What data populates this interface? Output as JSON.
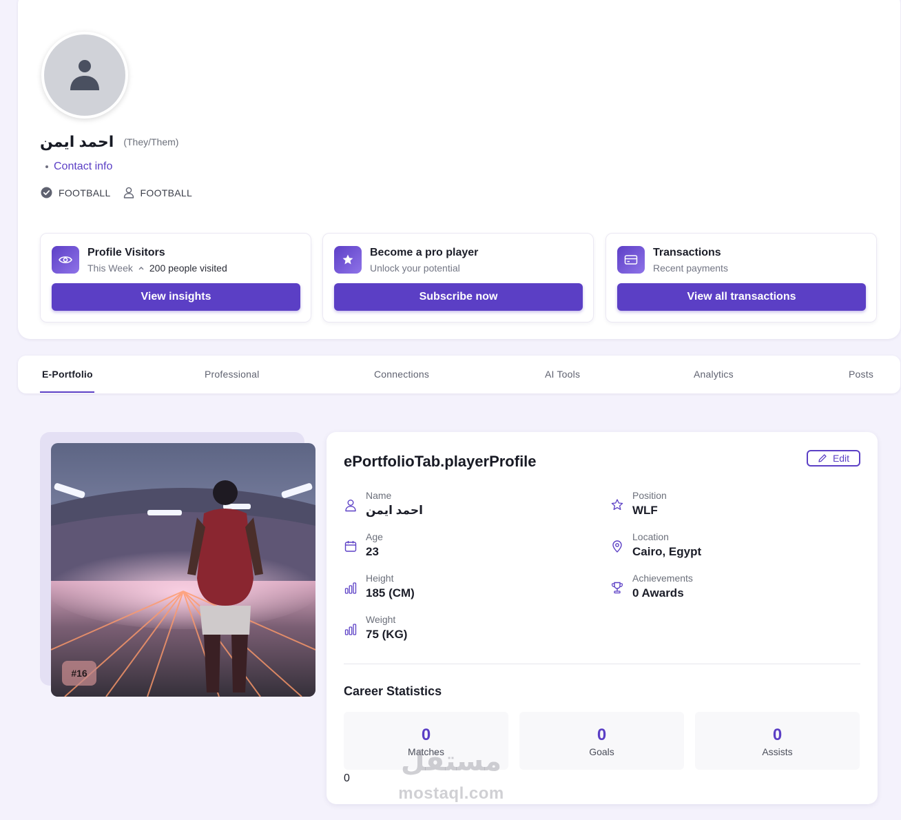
{
  "profile": {
    "name": "احمد ايمن",
    "pronouns": "(They/Them)",
    "contact_label": "Contact info",
    "tags": [
      {
        "icon": "check-circle-icon",
        "label": "FOOTBALL"
      },
      {
        "icon": "user-icon",
        "label": "FOOTBALL"
      }
    ]
  },
  "cards": {
    "visitors": {
      "title": "Profile Visitors",
      "period": "This Week",
      "count_text": "200 people visited",
      "button": "View insights",
      "icon": "eye-icon"
    },
    "pro": {
      "title": "Become a pro player",
      "subtitle": "Unlock your potential",
      "button": "Subscribe now",
      "icon": "star-icon"
    },
    "transactions": {
      "title": "Transactions",
      "subtitle": "Recent payments",
      "button": "View all transactions",
      "icon": "credit-card-icon"
    }
  },
  "tabs": [
    {
      "label": "E-Portfolio",
      "active": true
    },
    {
      "label": "Professional"
    },
    {
      "label": "Connections"
    },
    {
      "label": "AI Tools"
    },
    {
      "label": "Analytics"
    },
    {
      "label": "Posts"
    }
  ],
  "player": {
    "jersey": "#16",
    "panel_title": "ePortfolioTab.playerProfile",
    "edit_label": "Edit",
    "fields": {
      "name": {
        "label": "Name",
        "value": "احمد ايمن",
        "icon": "user-icon"
      },
      "position": {
        "label": "Position",
        "value": "WLF",
        "icon": "star-icon"
      },
      "age": {
        "label": "Age",
        "value": "23",
        "icon": "calendar-icon"
      },
      "location": {
        "label": "Location",
        "value": "Cairo, Egypt",
        "icon": "map-pin-icon"
      },
      "height": {
        "label": "Height",
        "value": "185 (CM)",
        "icon": "bar-chart-icon"
      },
      "achievements": {
        "label": "Achievements",
        "value": "0 Awards",
        "icon": "trophy-icon"
      },
      "weight": {
        "label": "Weight",
        "value": "75 (KG)",
        "icon": "bar-chart-icon"
      }
    },
    "stats_title": "Career Statistics",
    "stats": [
      {
        "value": "0",
        "label": "Matches"
      },
      {
        "value": "0",
        "label": "Goals"
      },
      {
        "value": "0",
        "label": "Assists"
      }
    ],
    "stray_value": "0"
  },
  "watermark": {
    "arabic": "مستقل",
    "latin": "mostaql.com"
  },
  "colors": {
    "accent": "#5b3fc5",
    "page_background": "#f4f2fc",
    "card_background": "#ffffff"
  }
}
